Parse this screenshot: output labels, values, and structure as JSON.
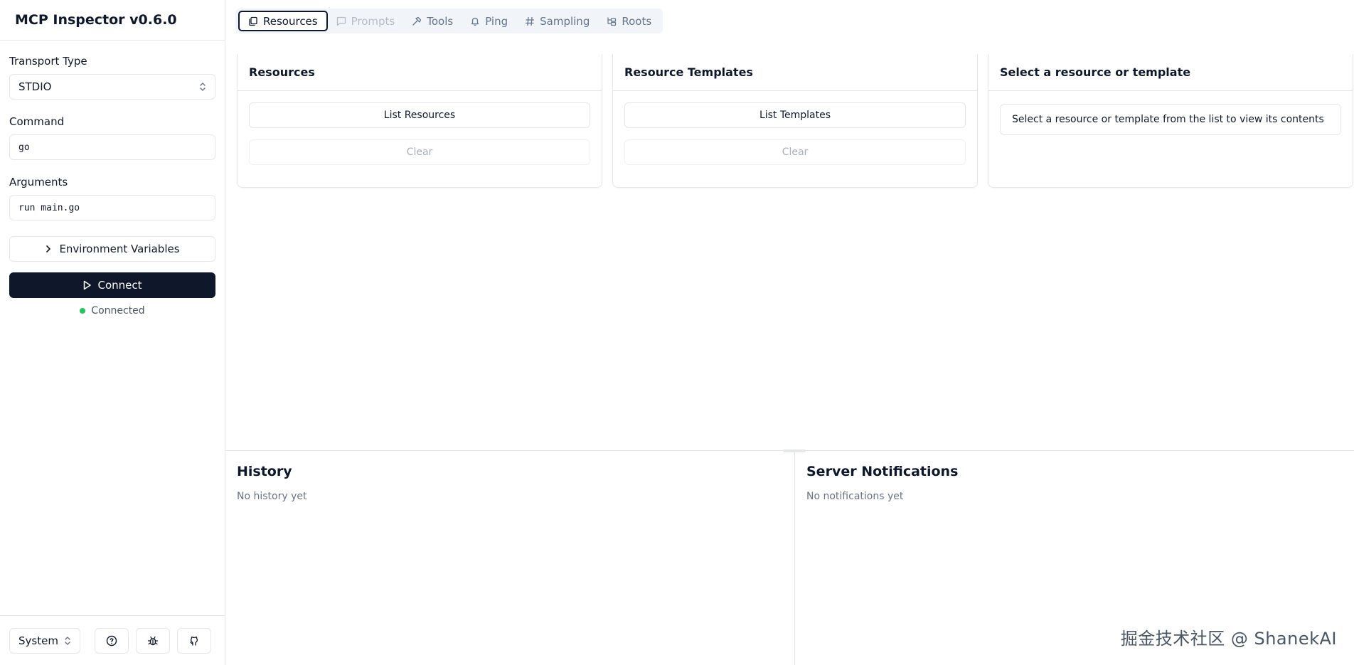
{
  "app": {
    "title": "MCP Inspector v0.6.0"
  },
  "sidebar": {
    "transport_label": "Transport Type",
    "transport_value": "STDIO",
    "command_label": "Command",
    "command_value": "go",
    "arguments_label": "Arguments",
    "arguments_value": "run main.go",
    "env_button": "Environment Variables",
    "connect_button": "Connect",
    "status_text": "Connected",
    "status_color": "#22c55e",
    "theme_value": "System"
  },
  "tabs": [
    {
      "label": "Resources",
      "icon": "files-icon",
      "state": "active"
    },
    {
      "label": "Prompts",
      "icon": "message-square-icon",
      "state": "disabled"
    },
    {
      "label": "Tools",
      "icon": "hammer-icon",
      "state": "normal"
    },
    {
      "label": "Ping",
      "icon": "bell-icon",
      "state": "normal"
    },
    {
      "label": "Sampling",
      "icon": "hash-icon",
      "state": "normal"
    },
    {
      "label": "Roots",
      "icon": "folder-tree-icon",
      "state": "normal"
    }
  ],
  "cards": {
    "resources": {
      "title": "Resources",
      "list_button": "List Resources",
      "clear_button": "Clear"
    },
    "templates": {
      "title": "Resource Templates",
      "list_button": "List Templates",
      "clear_button": "Clear"
    },
    "selection": {
      "title": "Select a resource or template",
      "placeholder": "Select a resource or template from the list to view its contents"
    }
  },
  "history": {
    "title": "History",
    "empty": "No history yet"
  },
  "notifications": {
    "title": "Server Notifications",
    "empty": "No notifications yet"
  },
  "watermark": "掘金技术社区 @ ShanekAI"
}
